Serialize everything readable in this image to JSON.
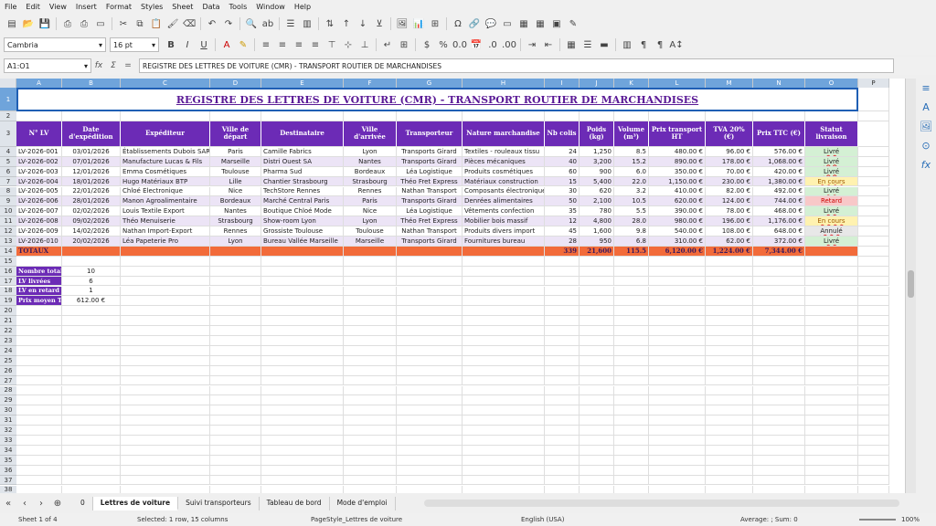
{
  "menu": [
    "File",
    "Edit",
    "View",
    "Insert",
    "Format",
    "Styles",
    "Sheet",
    "Data",
    "Tools",
    "Window",
    "Help"
  ],
  "font": {
    "name": "Cambria",
    "size": "16 pt"
  },
  "namebox": "A1:O1",
  "formula": "REGISTRE DES LETTRES DE VOITURE (CMR) - TRANSPORT ROUTIER DE MARCHANDISES",
  "columns": [
    "A",
    "B",
    "C",
    "D",
    "E",
    "F",
    "G",
    "H",
    "I",
    "J",
    "K",
    "L",
    "M",
    "N",
    "O",
    "P"
  ],
  "rows": [
    "1",
    "2",
    "3",
    "4",
    "5",
    "6",
    "7",
    "8",
    "9",
    "10",
    "11",
    "12",
    "13",
    "14",
    "15",
    "16",
    "17",
    "18",
    "19",
    "20",
    "21",
    "22",
    "23",
    "24",
    "25",
    "26",
    "27",
    "28",
    "29",
    "30",
    "31",
    "32",
    "33",
    "34",
    "35",
    "36",
    "37",
    "38",
    "39"
  ],
  "title": "REGISTRE DES LETTRES DE VOITURE (CMR) - TRANSPORT ROUTIER DE MARCHANDISES",
  "headers": [
    "N° LV",
    "Date d'expédition",
    "Expéditeur",
    "Ville de départ",
    "Destinataire",
    "Ville d'arrivée",
    "Transporteur",
    "Nature marchandise",
    "Nb colis",
    "Poids (kg)",
    "Volume (m³)",
    "Prix transport HT",
    "TVA 20% (€)",
    "Prix TTC (€)",
    "Statut livraison"
  ],
  "data_rows": [
    [
      "LV-2026-001",
      "03/01/2026",
      "Établissements Dubois SARL",
      "Paris",
      "Camille Fabrics",
      "Lyon",
      "Transports Girard",
      "Textiles - rouleaux tissu",
      "24",
      "1,250",
      "8.5",
      "480.00 €",
      "96.00 €",
      "576.00 €",
      "Livré"
    ],
    [
      "LV-2026-002",
      "07/01/2026",
      "Manufacture Lucas & Fils",
      "Marseille",
      "Distri Ouest SA",
      "Nantes",
      "Transports Girard",
      "Pièces mécaniques",
      "40",
      "3,200",
      "15.2",
      "890.00 €",
      "178.00 €",
      "1,068.00 €",
      "Livré"
    ],
    [
      "LV-2026-003",
      "12/01/2026",
      "Emma Cosmétiques",
      "Toulouse",
      "Pharma Sud",
      "Bordeaux",
      "Léa Logistique",
      "Produits cosmétiques",
      "60",
      "900",
      "6.0",
      "350.00 €",
      "70.00 €",
      "420.00 €",
      "Livré"
    ],
    [
      "LV-2026-004",
      "18/01/2026",
      "Hugo Matériaux BTP",
      "Lille",
      "Chantier Strasbourg",
      "Strasbourg",
      "Théo Fret Express",
      "Matériaux construction",
      "15",
      "5,400",
      "22.0",
      "1,150.00 €",
      "230.00 €",
      "1,380.00 €",
      "En cours"
    ],
    [
      "LV-2026-005",
      "22/01/2026",
      "Chloé Électronique",
      "Nice",
      "TechStore Rennes",
      "Rennes",
      "Nathan Transport",
      "Composants électroniques",
      "30",
      "620",
      "3.2",
      "410.00 €",
      "82.00 €",
      "492.00 €",
      "Livré"
    ],
    [
      "LV-2026-006",
      "28/01/2026",
      "Manon Agroalimentaire",
      "Bordeaux",
      "Marché Central Paris",
      "Paris",
      "Transports Girard",
      "Denrées alimentaires",
      "50",
      "2,100",
      "10.5",
      "620.00 €",
      "124.00 €",
      "744.00 €",
      "Retard"
    ],
    [
      "LV-2026-007",
      "02/02/2026",
      "Louis Textile Export",
      "Nantes",
      "Boutique Chloé Mode",
      "Nice",
      "Léa Logistique",
      "Vêtements confection",
      "35",
      "780",
      "5.5",
      "390.00 €",
      "78.00 €",
      "468.00 €",
      "Livré"
    ],
    [
      "LV-2026-008",
      "09/02/2026",
      "Théo Menuiserie",
      "Strasbourg",
      "Show-room Lyon",
      "Lyon",
      "Théo Fret Express",
      "Mobilier bois massif",
      "12",
      "4,800",
      "28.0",
      "980.00 €",
      "196.00 €",
      "1,176.00 €",
      "En cours"
    ],
    [
      "LV-2026-009",
      "14/02/2026",
      "Nathan Import-Export",
      "Rennes",
      "Grossiste Toulouse",
      "Toulouse",
      "Nathan Transport",
      "Produits divers import",
      "45",
      "1,600",
      "9.8",
      "540.00 €",
      "108.00 €",
      "648.00 €",
      "Annulé"
    ],
    [
      "LV-2026-010",
      "20/02/2026",
      "Léa Papeterie Pro",
      "Lyon",
      "Bureau Vallée Marseille",
      "Marseille",
      "Transports Girard",
      "Fournitures bureau",
      "28",
      "950",
      "6.8",
      "310.00 €",
      "62.00 €",
      "372.00 €",
      "Livré"
    ]
  ],
  "totals": {
    "label": "TOTAUX",
    "nb_colis": "339",
    "poids": "21,600",
    "volume": "115.5",
    "ht": "6,120.00 €",
    "tva": "1,224.00 €",
    "ttc": "7,344.00 €"
  },
  "stats": [
    {
      "label": "Nombre total LV",
      "value": "10"
    },
    {
      "label": "LV livrées",
      "value": "6"
    },
    {
      "label": "LV en retard",
      "value": "1"
    },
    {
      "label": "Prix moyen TTC",
      "value": "612.00 €"
    }
  ],
  "status_colors": {
    "Livré": "#d4f0d4",
    "En cours": "#fff2b0",
    "Retard": "#f8c8c8",
    "Annulé": "#e8e8e8"
  },
  "sheet_tabs": [
    "Lettres de voiture",
    "Suivi transporteurs",
    "Tableau de bord",
    "Mode d'emploi"
  ],
  "statusbar": {
    "sheet": "Sheet 1 of 4",
    "selected": "Selected: 1 row, 15 columns",
    "pagestyle": "PageStyle_Lettres de voiture",
    "lang": "English (USA)",
    "agg": "Average: ; Sum: 0",
    "zoom": "100%"
  }
}
